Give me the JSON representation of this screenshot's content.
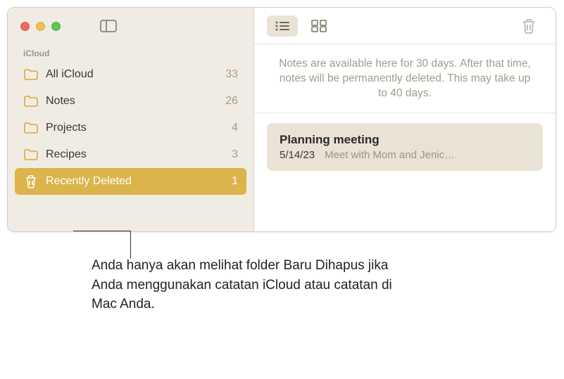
{
  "sidebar": {
    "section": "iCloud",
    "folders": [
      {
        "label": "All iCloud",
        "count": "33",
        "icon": "folder"
      },
      {
        "label": "Notes",
        "count": "26",
        "icon": "folder"
      },
      {
        "label": "Projects",
        "count": "4",
        "icon": "folder"
      },
      {
        "label": "Recipes",
        "count": "3",
        "icon": "folder"
      },
      {
        "label": "Recently Deleted",
        "count": "1",
        "icon": "trash"
      }
    ]
  },
  "banner": "Notes are available here for 30 days. After that time, notes will be permanently deleted. This may take up to 40 days.",
  "note": {
    "title": "Planning meeting",
    "date": "5/14/23",
    "preview": "Meet with Mom and Jenic…"
  },
  "callout": "Anda hanya akan melihat folder Baru Dihapus jika Anda menggunakan catatan iCloud atau catatan di Mac Anda."
}
